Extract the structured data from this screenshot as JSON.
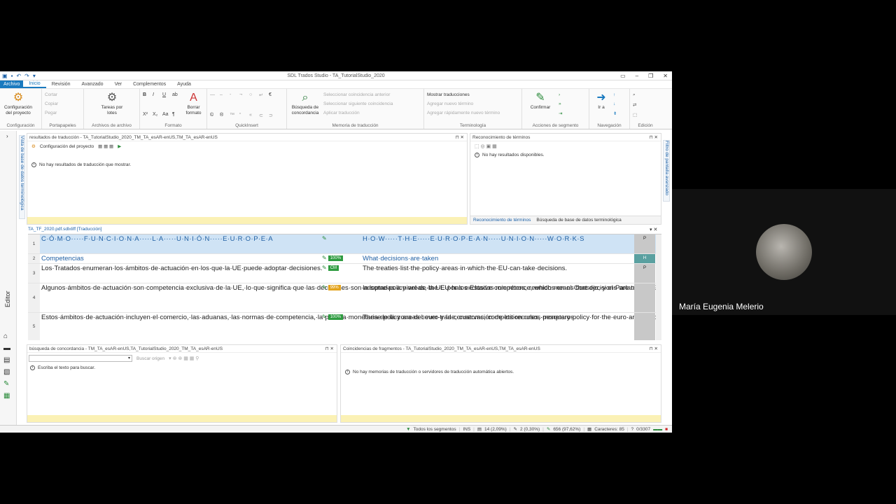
{
  "window": {
    "title": "SDL Trados Studio - TA_TutorialStudio_2020"
  },
  "menu": {
    "file": "Archivo",
    "tabs": [
      "Inicio",
      "Revisión",
      "Avanzado",
      "Ver",
      "Complementos",
      "Ayuda"
    ]
  },
  "ribbon": {
    "config": {
      "button": "Configuración del proyecto",
      "label": "Configuración"
    },
    "clipboard": {
      "items": [
        "Cortar",
        "Copiar",
        "Pegar"
      ],
      "label": "Portapapeles"
    },
    "batch": {
      "button": "Tareas por lotes",
      "label": "Archivos de archivo"
    },
    "format": {
      "button": "Borrar formato",
      "label": "Formato"
    },
    "quicksert": {
      "label": "QuickInsert"
    },
    "tm": {
      "button": "Búsqueda de concordancia",
      "items": [
        "Seleccionar coincidencia anterior",
        "Seleccionar siguiente coincidencia",
        "Aplicar traducción"
      ],
      "label": "Memoria de traducción"
    },
    "term": {
      "items": [
        "Mostrar traducciones",
        "Agregar nuevo término",
        "Agregar rápidamente nuevo término"
      ],
      "label": "Terminología"
    },
    "segment": {
      "button": "Confirmar",
      "label": "Acciones de segmento"
    },
    "nav": {
      "button": "Ir a",
      "label": "Navegación"
    },
    "edit": {
      "label": "Edición"
    }
  },
  "panes": {
    "results": {
      "title": "resultados de traducción - TA_TutorialStudio_2020_TM_TA_esAR-enUS,TM_TA_esAR-enUS",
      "toolbar_label": "Configuración del proyecto",
      "message": "No hay resultados de traducción que mostrar."
    },
    "termrec": {
      "title": "Reconocimiento de términos",
      "message": "No hay resultados disponibles.",
      "tab1": "Reconocimiento de términos",
      "tab2": "Búsqueda de base de datos terminológica"
    },
    "concordance": {
      "title": "búsqueda de concordancia - TM_TA_esAR-enUS,TA_TutorialStudio_2020_TM_TA_esAR-enUS",
      "search_btn": "Buscar origen",
      "message": "Escriba el texto para buscar."
    },
    "fragments": {
      "title": "Coincidencias de fragmentos - TA_TutorialStudio_2020_TM_TA_esAR-enUS,TM_TA_esAR-enUS",
      "message": "No hay memorias de traducción o servidores de traducción automática abiertos."
    }
  },
  "sidebar": {
    "editor_label": "Editor",
    "left_vtab": "Vista de base de datos terminológica",
    "right_vtab": "Filtro de pantalla avanzado"
  },
  "editor": {
    "file_tab": "TA_TF_2020.pdf.sdlxliff [Traducción]",
    "segments": [
      {
        "num": "1",
        "src": "C·Ó·M·O·····F·U·N·C·I·O·N·A·····L·A·····U·N·I·Ó·N·····E·U·R·O·P·E·A",
        "status": "",
        "tgt": "H·O·W·····T·H·E·····E·U·R·O·P·E·A·N·····U·N·I·O·N·····W·O·R·K·S",
        "flag": "P"
      },
      {
        "num": "2",
        "src": "Competencias",
        "status": "100%",
        "tgt": "What·decisions·are·taken",
        "flag": "H"
      },
      {
        "num": "3",
        "src": "Los·Tratados·enumeran·los·ámbitos·de·actuación·en·los·que·la·UE·puede·adoptar·decisiones.",
        "status": "CM",
        "tgt": "The·treaties·list·the·policy·areas·in·which·the·EU·can·take·decisions.",
        "flag": "P"
      },
      {
        "num": "4",
        "src": "Algunos·ámbitos·de·actuación·son·competencia·exclusiva·de·la·UE,·lo·que·significa·que·las·decisiones·son·adoptadas·a·nivel·de·la·UE·por·los·Estados·miembros,·reunidos·en·el·Consejo,·y·el·Parlamento·Europeo.",
        "status": "99%",
        "tgt": "In·some·policy·areas,·the·EU·has·exclusive·competence,·which·means·that·decisions·are·taken·at·EU·level·by·the·Member·States·meeting·in·the·Council·and·the·European·Parliament.",
        "flag": ""
      },
      {
        "num": "5",
        "src": "Estos·ámbitos·de·actuación·incluyen·el·comercio,·las·aduanas,·las·normas·de·competencia,·la·política·monetaria·de·la·zona·del·euro·y·la·conservación·de·los·recursos·pesqueros.",
        "status": "100%",
        "tgt": "These·policy·areas·cover·trade,·customs,·competition·rules,·monetary·policy·for·the·euro·area,·and·the·conservation·of·fish.",
        "flag": ""
      }
    ]
  },
  "status": {
    "filter": "Todos los segmentos",
    "mode": "INS",
    "a": "14 (2,09%)",
    "b": "2 (0,30%)",
    "c": "656 (97,62%)",
    "chars": "Caracteres: 85",
    "pos": "0/3307"
  },
  "video": {
    "name": "María Eugenia Melerio"
  },
  "colors": {
    "accent": "#1a7abf",
    "match_green": "#2f9c41",
    "fuzzy_orange": "#e3a31c",
    "highlight_row": "#cfe3f5"
  }
}
